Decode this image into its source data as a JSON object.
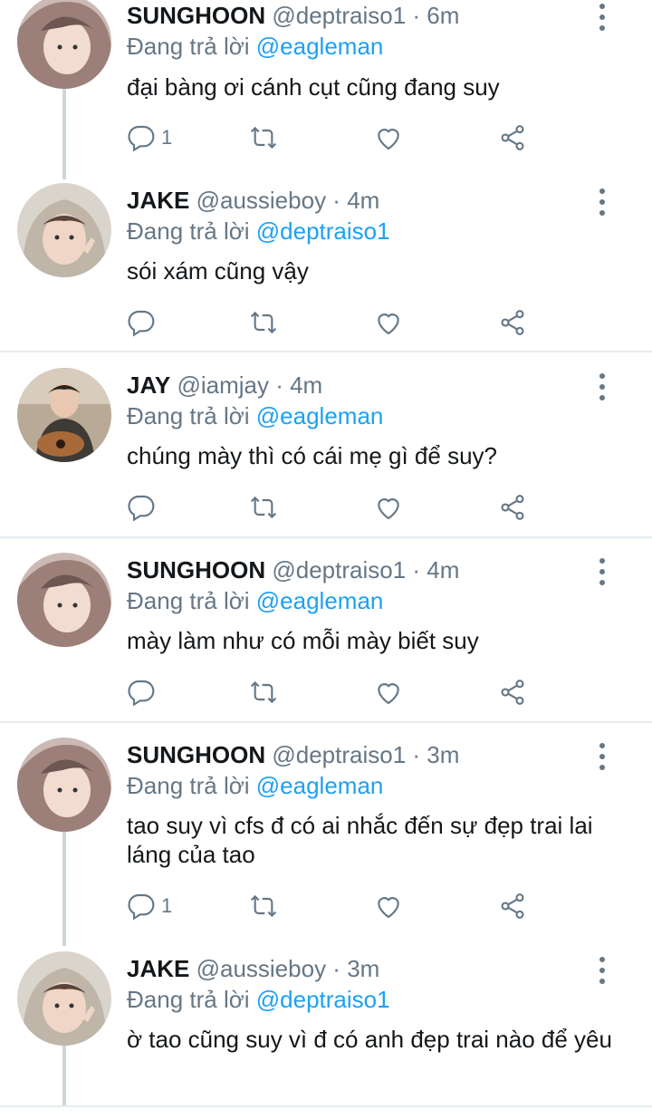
{
  "tweets": [
    {
      "name": "SUNGHOON",
      "handle": "@deptraiso1",
      "dot": " · ",
      "time": "6m",
      "reply_prefix": "Đang trả lời ",
      "reply_to": "@eagleman",
      "text": "đại bàng ơi cánh cụt cũng đang suy",
      "reply_count": "1"
    },
    {
      "name": "JAKE",
      "handle": "@aussieboy",
      "dot": " · ",
      "time": "4m",
      "reply_prefix": "Đang trả lời ",
      "reply_to": "@deptraiso1",
      "text": "sói xám cũng vậy",
      "reply_count": ""
    },
    {
      "name": "JAY",
      "handle": "@iamjay",
      "dot": " · ",
      "time": "4m",
      "reply_prefix": "Đang trả lời ",
      "reply_to": "@eagleman",
      "text": "chúng mày thì có cái mẹ gì để suy?",
      "reply_count": ""
    },
    {
      "name": "SUNGHOON",
      "handle": "@deptraiso1",
      "dot": " · ",
      "time": "4m",
      "reply_prefix": "Đang trả lời ",
      "reply_to": "@eagleman",
      "text": "mày làm như có mỗi mày biết suy",
      "reply_count": ""
    },
    {
      "name": "SUNGHOON",
      "handle": "@deptraiso1",
      "dot": " · ",
      "time": "3m",
      "reply_prefix": "Đang trả lời ",
      "reply_to": "@eagleman",
      "text": "tao suy vì cfs đ có ai nhắc đến sự đẹp trai lai láng của tao",
      "reply_count": "1"
    },
    {
      "name": "JAKE",
      "handle": "@aussieboy",
      "dot": " · ",
      "time": "3m",
      "reply_prefix": "Đang trả lời ",
      "reply_to": "@deptraiso1",
      "text": "ờ tao cũng suy vì đ có anh đẹp trai nào để yêu",
      "reply_count": ""
    }
  ],
  "icons": {
    "reply": "reply-icon",
    "retweet": "retweet-icon",
    "like": "heart-icon",
    "share": "share-icon",
    "more": "more-vertical-icon"
  },
  "colors": {
    "name": "#14171a",
    "muted": "#657786",
    "mention": "#1da1f2",
    "divider": "#e6ecf0",
    "thread_line": "#ccd6dd"
  }
}
